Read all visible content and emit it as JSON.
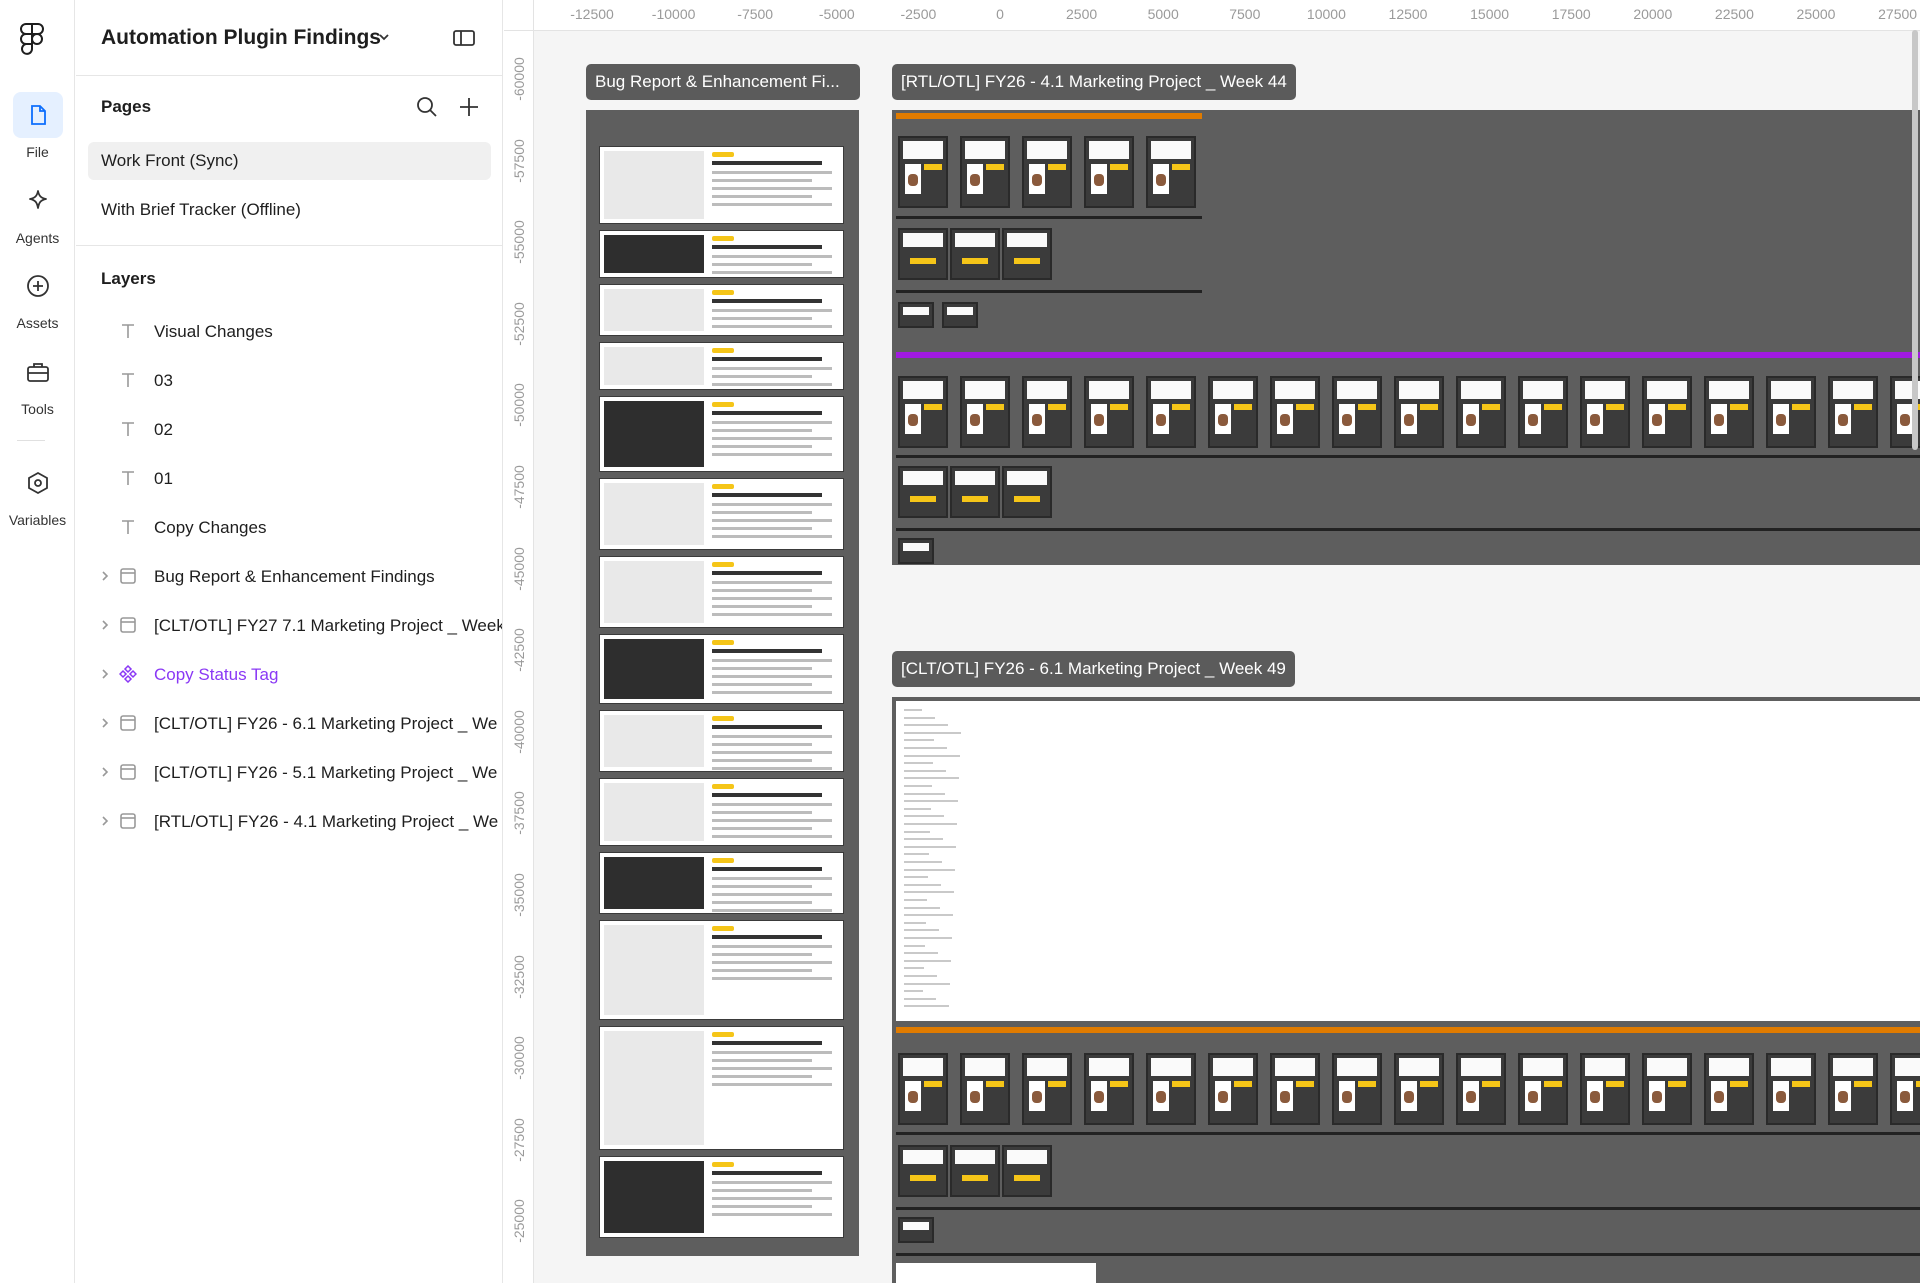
{
  "rail": {
    "items": [
      {
        "label": "File",
        "icon": "file-icon",
        "active": true
      },
      {
        "label": "Agents",
        "icon": "sparkle-icon"
      },
      {
        "label": "Assets",
        "icon": "plus-circle-icon"
      },
      {
        "label": "Tools",
        "icon": "toolbox-icon"
      },
      {
        "label": "Variables",
        "icon": "hexagon-icon"
      }
    ]
  },
  "panel": {
    "file_title": "Automation Plugin Findings",
    "pages_title": "Pages",
    "pages": [
      {
        "name": "Work Front (Sync)",
        "selected": true
      },
      {
        "name": "With Brief Tracker (Offline)"
      }
    ],
    "layers_title": "Layers",
    "layers": [
      {
        "name": "Visual Changes",
        "type": "text"
      },
      {
        "name": "03",
        "type": "text"
      },
      {
        "name": "02",
        "type": "text"
      },
      {
        "name": "01",
        "type": "text"
      },
      {
        "name": "Copy Changes",
        "type": "text"
      },
      {
        "name": "Bug Report & Enhancement Findings",
        "type": "frame"
      },
      {
        "name": "[CLT/OTL] FY27 7.1 Marketing Project _ Week",
        "type": "frame"
      },
      {
        "name": "Copy Status Tag",
        "type": "component"
      },
      {
        "name": "[CLT/OTL] FY26 - 6.1 Marketing Project _ We",
        "type": "frame"
      },
      {
        "name": "[CLT/OTL] FY26 - 5.1 Marketing Project _ We",
        "type": "frame"
      },
      {
        "name": "[RTL/OTL] FY26 - 4.1 Marketing Project _ We",
        "type": "frame"
      }
    ]
  },
  "canvas": {
    "ruler_top": [
      "-12500",
      "-10000",
      "-7500",
      "-5000",
      "-2500",
      "0",
      "2500",
      "5000",
      "7500",
      "10000",
      "12500",
      "15000",
      "17500",
      "20000",
      "22500",
      "25000",
      "27500"
    ],
    "ruler_left": [
      "-60000",
      "-57500",
      "-55000",
      "-52500",
      "-50000",
      "-47500",
      "-45000",
      "-42500",
      "-40000",
      "-37500",
      "-35000",
      "-32500",
      "-30000",
      "-27500",
      "-25000"
    ],
    "frames": {
      "bug_report": "Bug Report & Enhancement Fi...",
      "week44": "[RTL/OTL] FY26 - 4.1 Marketing Project _ Week 44",
      "week49": "[CLT/OTL] FY26 - 6.1 Marketing Project _ Week 49"
    },
    "colors": {
      "orange_bar": "#e07b00",
      "purple_bar": "#a11be0",
      "frame_bg": "#5e5e5e"
    }
  }
}
